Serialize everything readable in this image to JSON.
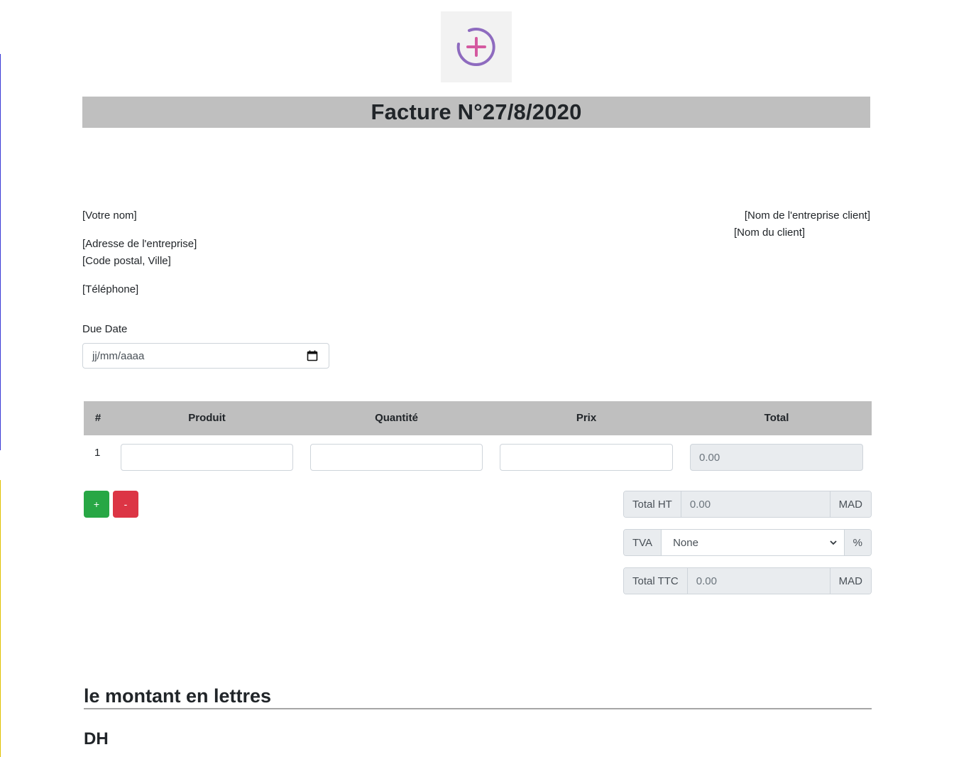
{
  "logo": {
    "icon": "plus-circle-icon",
    "colors": {
      "ring": "#8e6bbf",
      "plus": "#d45aa0"
    }
  },
  "invoice": {
    "title": "Facture N°27/8/2020"
  },
  "sender": {
    "name": "[Votre nom]",
    "address": "[Adresse de l'entreprise]",
    "city": "[Code postal, Ville]",
    "phone": "[Téléphone]"
  },
  "client": {
    "company": "[Nom de l'entreprise client]",
    "name": "[Nom du client]"
  },
  "due_date": {
    "label": "Due Date",
    "placeholder": "jj/mm/aaaa",
    "icon": "calendar-icon"
  },
  "table": {
    "headers": [
      "#",
      "Produit",
      "Quantité",
      "Prix",
      "Total"
    ],
    "rows": [
      {
        "index": "1",
        "produit": "",
        "quantite": "",
        "prix": "",
        "total": "0.00"
      }
    ]
  },
  "buttons": {
    "add": "+",
    "remove": "-"
  },
  "totals": {
    "ht_label": "Total HT",
    "ht_value": "0.00",
    "ht_unit": "MAD",
    "tva_label": "TVA",
    "tva_value": "None",
    "tva_unit": "%",
    "ttc_label": "Total TTC",
    "ttc_value": "0.00",
    "ttc_unit": "MAD"
  },
  "amount_words": {
    "title": "le montant en lettres",
    "currency": "DH"
  },
  "colors": {
    "header_bg": "#bfbfbf",
    "add_button": "#28a745",
    "remove_button": "#dc3545",
    "readonly_bg": "#e9ecef"
  }
}
